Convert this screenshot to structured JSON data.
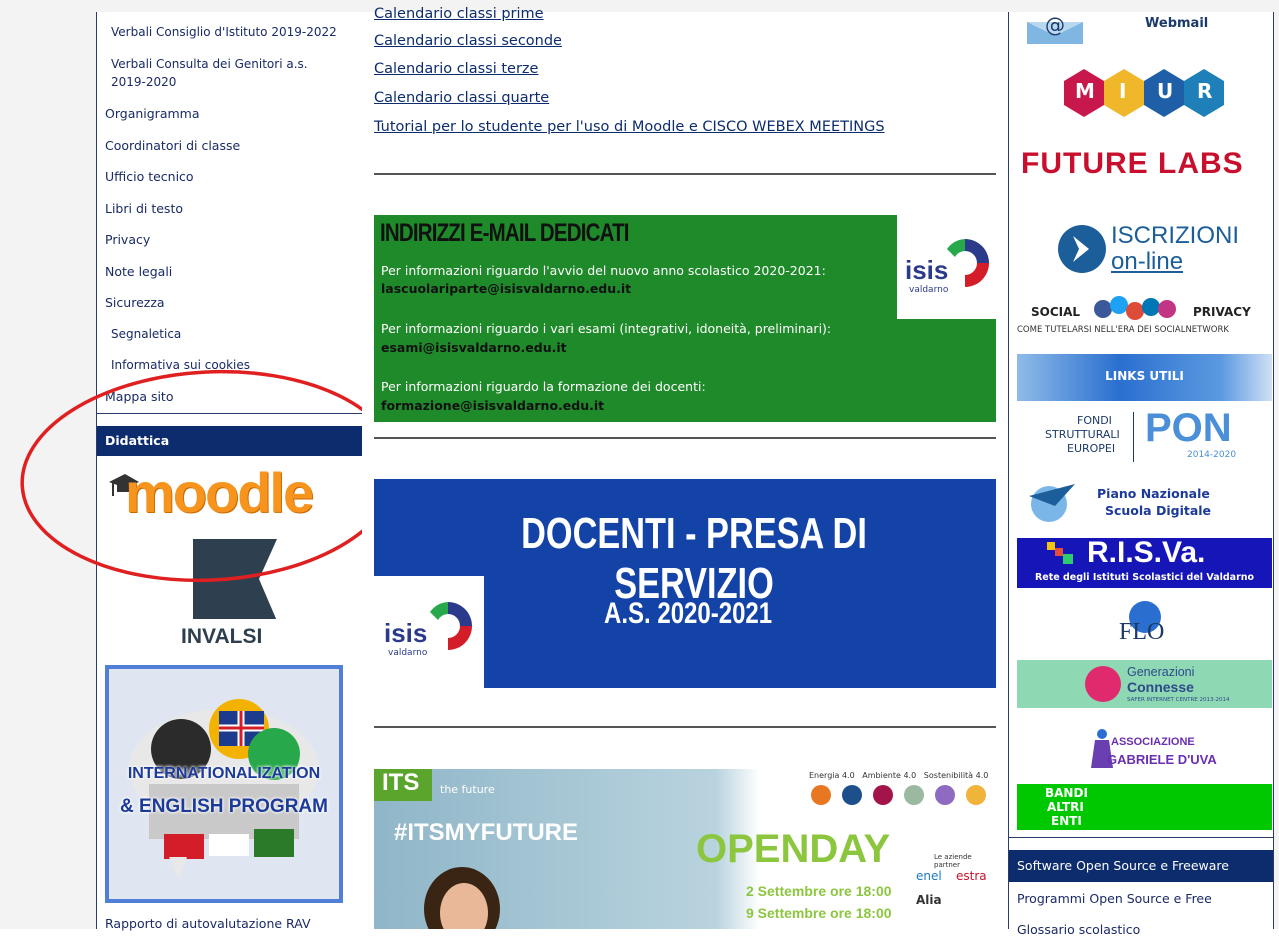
{
  "colors": {
    "navy": "#0d2c6e",
    "green": "#1f8a2a",
    "blue_banner": "#1443a8",
    "moodle_orange": "#f7941d",
    "red": "#e02020",
    "accent_green": "#00c800"
  },
  "left": {
    "links": [
      {
        "label": "Verbali Consiglio d'Istituto 2019-2022",
        "sub": true
      },
      {
        "label": "Verbali Consulta dei Genitori a.s.",
        "sub": true
      },
      {
        "label": "2019-2020",
        "sub": true
      },
      {
        "label": "Organigramma",
        "sub": false
      },
      {
        "label": "Coordinatori di classe",
        "sub": false
      },
      {
        "label": "Ufficio tecnico",
        "sub": false
      },
      {
        "label": "Libri di testo",
        "sub": false
      },
      {
        "label": "Privacy",
        "sub": false
      },
      {
        "label": "Note legali",
        "sub": false
      },
      {
        "label": "Sicurezza",
        "sub": false
      },
      {
        "label": "Segnaletica",
        "sub": true
      },
      {
        "label": "Informativa sui cookies",
        "sub": true
      },
      {
        "label": "Mappa sito",
        "sub": false
      }
    ],
    "didattica_title": "Didattica",
    "moodle_text": "moodle",
    "invalsi_text": "INVALSI",
    "intl_line1": "INTERNATIONALIZATION",
    "intl_line2": "& ENGLISH PROGRAM",
    "rav_label": "Rapporto di autovalutazione RAV"
  },
  "center": {
    "links": [
      "Calendario classi prime",
      "Calendario classi seconde",
      "Calendario classi terze",
      "Calendario classi quarte",
      "Tutorial per lo studente per l'uso di Moodle e CISCO WEBEX MEETINGS"
    ],
    "email_box": {
      "title": "INDIRIZZI E-MAIL DEDICATI",
      "p1": "Per informazioni riguardo l'avvio del nuovo anno scolastico 2020-2021:",
      "e1": "lascuolariparte@isisvaldarno.edu.it",
      "p2": "Per informazioni riguardo i vari esami (integrativi, idoneità, preliminari):",
      "e2": "esami@isisvaldarno.edu.it",
      "p3": "Per informazioni riguardo la formazione dei docenti:",
      "e3": "formazione@isisvaldarno.edu.it"
    },
    "isis_logo": {
      "name": "isis",
      "sub": "valdarno"
    },
    "docenti": {
      "title": "DOCENTI - PRESA DI SERVIZIO",
      "year": "A.S. 2020-2021"
    },
    "its": {
      "brand": "ITS",
      "brand_sub": "the future",
      "hashtag": "#ITSMYFUTURE",
      "openday": "OPENDAY",
      "date1": "2 Settembre ore 18:00",
      "date2": "9 Settembre ore 18:00",
      "sectors": "Energia 4.0   Ambiente 4.0   Sostenibilità 4.0",
      "partner_title": "Le aziende partner",
      "partner1": "enel",
      "partner2": "estra",
      "partner3": "Alia"
    }
  },
  "right": {
    "webmail": "Webmail",
    "miur": [
      "M",
      "I",
      "U",
      "R"
    ],
    "futurelabs": "FUTURE LABS",
    "iscrizioni_1": "ISCRIZIONI",
    "iscrizioni_2": "on-line",
    "social_left": "SOCIAL",
    "social_right": "PRIVACY",
    "social_sub": "COME TUTELARSI NELL'ERA DEI SOCIALNETWORK",
    "links_utili": "LINKS UTILI",
    "pon_left1": "FONDI",
    "pon_left2": "STRUTTURALI",
    "pon_left3": "EUROPEI",
    "pon_big": "PON",
    "pon_years": "2014-2020",
    "pnsd_1": "Piano Nazionale",
    "pnsd_2": "Scuola Digitale",
    "risva": "R.I.S.Va.",
    "risva_sub": "Rete degli Istituti Scolastici del Valdarno",
    "flo": "FLO",
    "gen_1": "Generazioni",
    "gen_2": "Connesse",
    "gen_sub": "SAFER INTERNET CENTRE 2013-2014",
    "assoc_1": "ASSOCIAZIONE",
    "assoc_2": "GABRIELE D'UVA",
    "bandi": [
      "BANDI",
      "ALTRI",
      "ENTI"
    ],
    "software_title": "Software Open Source e Freeware",
    "software_links": [
      "Programmi Open Source e Free",
      "Glossario scolastico"
    ]
  }
}
